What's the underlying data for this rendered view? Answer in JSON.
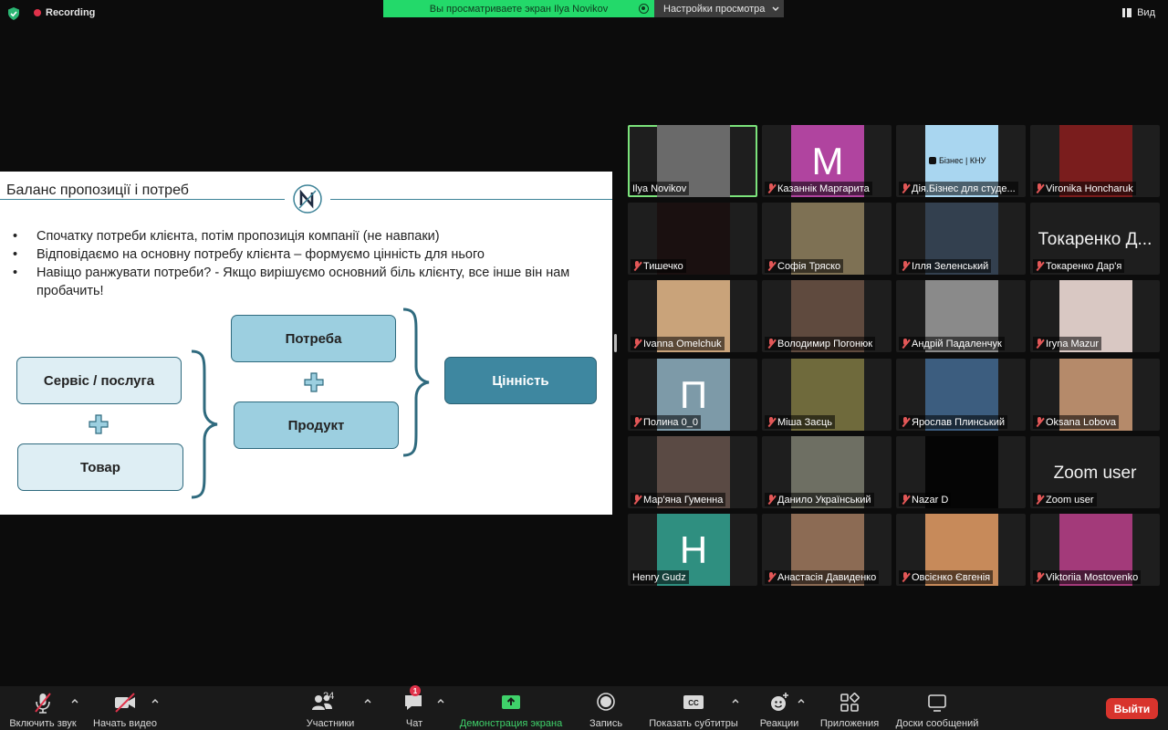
{
  "topbar": {
    "recording": "Recording",
    "banner": "Вы просматриваете экран Ilya Novikov",
    "view_options": "Настройки просмотра",
    "view": "Вид"
  },
  "slide": {
    "title": "Баланс пропозиції і потреб",
    "bullets": [
      "Спочатку потреби клієнта, потім пропозиція компанії (не навпаки)",
      "Відповідаємо на основну потребу клієнта – формуємо цінність для нього",
      "Навіщо ранжувати потреби? - Якщо вирішуємо основний біль клієнту, все інше він нам пробачить!"
    ],
    "boxes": {
      "service": "Сервіс / послуга",
      "product_goods": "Товар",
      "need": "Потреба",
      "product": "Продукт",
      "value": "Цінність"
    }
  },
  "participants": [
    {
      "name": "Ilya Novikov",
      "muted": false,
      "active": true,
      "kind": "video",
      "color": "#6a6a6a"
    },
    {
      "name": "Казаннік Маргарита",
      "muted": true,
      "kind": "letter",
      "letter": "M",
      "color": "#b0449f"
    },
    {
      "name": "Дія.Бізнес для студе...",
      "muted": true,
      "kind": "logo",
      "logo_text": "Бізнес | КНУ",
      "color": "#a9d6f0"
    },
    {
      "name": "Vironika Honcharuk",
      "muted": true,
      "kind": "video",
      "color": "#7a1d1d"
    },
    {
      "name": "Тишечко",
      "muted": true,
      "kind": "video",
      "color": "#1a1010"
    },
    {
      "name": "Софія Тряско",
      "muted": true,
      "kind": "video",
      "color": "#7e7154"
    },
    {
      "name": "Ілля Зеленський",
      "muted": true,
      "kind": "video",
      "color": "#33404f"
    },
    {
      "name": "Токаренко Дар'я",
      "muted": true,
      "kind": "text",
      "big": "Токаренко Д..."
    },
    {
      "name": "Ivanna Omelchuk",
      "muted": true,
      "kind": "video",
      "color": "#c9a37a"
    },
    {
      "name": "Володимир Погонюк",
      "muted": true,
      "kind": "video",
      "color": "#5f4a3e"
    },
    {
      "name": "Андрій Падаленчук",
      "muted": true,
      "kind": "video",
      "color": "#8a8a8a"
    },
    {
      "name": "Iryna Mazur",
      "muted": true,
      "kind": "video",
      "color": "#d9c8c3"
    },
    {
      "name": "Полина 0_0",
      "muted": true,
      "kind": "letter",
      "letter": "П",
      "color": "#7d9aa8"
    },
    {
      "name": "Міша Заєць",
      "muted": true,
      "kind": "video",
      "color": "#6f6a3c"
    },
    {
      "name": "Ярослав Плинський",
      "muted": true,
      "kind": "video",
      "color": "#3c5d7f"
    },
    {
      "name": "Oksana Lobova",
      "muted": true,
      "kind": "video",
      "color": "#b58a6a"
    },
    {
      "name": "Мар'яна Гуменна",
      "muted": true,
      "kind": "video",
      "color": "#5a4a44"
    },
    {
      "name": "Данило Український",
      "muted": true,
      "kind": "video",
      "color": "#6e6f63"
    },
    {
      "name": "Nazar D",
      "muted": true,
      "kind": "video",
      "color": "#050505"
    },
    {
      "name": "Zoom user",
      "muted": true,
      "kind": "text",
      "big": "Zoom user"
    },
    {
      "name": "Henry Gudz",
      "muted": false,
      "kind": "letter",
      "letter": "H",
      "color": "#2f8f80"
    },
    {
      "name": "Анастасія Давиденко",
      "muted": true,
      "kind": "video",
      "color": "#8c6b54"
    },
    {
      "name": "Овсієнко Євгенія",
      "muted": true,
      "kind": "video",
      "color": "#c78a5a"
    },
    {
      "name": "Viktoriia Mostovenko",
      "muted": true,
      "kind": "video",
      "color": "#a33a7a"
    }
  ],
  "toolbar": {
    "unmute": "Включить звук",
    "start_video": "Начать видео",
    "participants": "Участники",
    "participants_count": "24",
    "chat": "Чат",
    "chat_badge": "1",
    "share": "Демонстрация экрана",
    "record": "Запись",
    "captions": "Показать субтитры",
    "captions_icon_text": "CC",
    "reactions": "Реакции",
    "apps": "Приложения",
    "whiteboards": "Доски сообщений",
    "leave": "Выйти"
  }
}
